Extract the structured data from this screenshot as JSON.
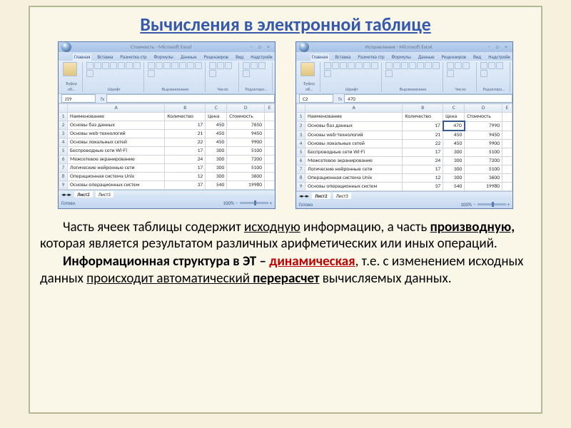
{
  "title": "Вычисления в электронной таблице",
  "screenshots": {
    "left": {
      "window_title": "Стоимость - Microsoft Excel",
      "tabs": [
        "Главная",
        "Вставка",
        "Разметка стр",
        "Формулы",
        "Данные",
        "Рецензиров",
        "Вид",
        "Надстройк"
      ],
      "active_tab": "Главная",
      "ribbon_groups": [
        "Буфер об…",
        "Шрифт",
        "Выравнивание",
        "Число",
        "Редактиро…"
      ],
      "name_box": "J19",
      "formula": "",
      "columns": [
        "",
        "A",
        "B",
        "C",
        "D",
        "E"
      ],
      "rows": [
        {
          "n": "1",
          "cells": [
            "Наименование",
            "Количество",
            "Цена",
            "Стоимость",
            ""
          ]
        },
        {
          "n": "2",
          "cells": [
            "Основы баз данных",
            "17",
            "450",
            "7650",
            ""
          ]
        },
        {
          "n": "3",
          "cells": [
            "Основы web-технологий",
            "21",
            "450",
            "9450",
            ""
          ]
        },
        {
          "n": "4",
          "cells": [
            "Основы локальных сетей",
            "22",
            "450",
            "9900",
            ""
          ]
        },
        {
          "n": "5",
          "cells": [
            "Беспроводные сети Wi-Fi",
            "17",
            "300",
            "5100",
            ""
          ]
        },
        {
          "n": "6",
          "cells": [
            "Межсетевое экранирование",
            "24",
            "300",
            "7200",
            ""
          ]
        },
        {
          "n": "7",
          "cells": [
            "Логические нейронные сети",
            "17",
            "300",
            "5100",
            ""
          ]
        },
        {
          "n": "8",
          "cells": [
            "Операционная система Unix",
            "12",
            "300",
            "3600",
            ""
          ]
        },
        {
          "n": "9",
          "cells": [
            "Основы операционных систем",
            "37",
            "540",
            "19980",
            ""
          ]
        }
      ],
      "sheet_tabs": [
        "Лист2",
        "Лист3"
      ],
      "active_sheet": "Лист2",
      "status": "Готово",
      "zoom": "100%"
    },
    "right": {
      "window_title": "Исправления - Microsoft Excel",
      "tabs": [
        "Главная",
        "Вставка",
        "Разметка стр",
        "Формулы",
        "Данные",
        "Рецензиров",
        "Вид",
        "Надстройк"
      ],
      "active_tab": "Главная",
      "ribbon_groups": [
        "Буфер об…",
        "Шрифт",
        "Выравнивание",
        "Число",
        "Редактиро…"
      ],
      "name_box": "C2",
      "formula": "470",
      "columns": [
        "",
        "A",
        "B",
        "C",
        "D",
        "E"
      ],
      "selected_cell": {
        "row": 0,
        "col": 2
      },
      "rows": [
        {
          "n": "1",
          "cells": [
            "Наименование",
            "Количество",
            "Цена",
            "Стоимость",
            ""
          ]
        },
        {
          "n": "2",
          "cells": [
            "Основы баз данных",
            "17",
            "470",
            "7990",
            ""
          ]
        },
        {
          "n": "3",
          "cells": [
            "Основы web-технологий",
            "21",
            "450",
            "9450",
            ""
          ]
        },
        {
          "n": "4",
          "cells": [
            "Основы локальных сетей",
            "22",
            "450",
            "9900",
            ""
          ]
        },
        {
          "n": "5",
          "cells": [
            "Беспроводные сети Wi-Fi",
            "17",
            "300",
            "5100",
            ""
          ]
        },
        {
          "n": "6",
          "cells": [
            "Межсетевое экранирование",
            "24",
            "300",
            "7200",
            ""
          ]
        },
        {
          "n": "7",
          "cells": [
            "Логические нейронные сети",
            "17",
            "300",
            "5100",
            ""
          ]
        },
        {
          "n": "8",
          "cells": [
            "Операционная система Unix",
            "12",
            "300",
            "3600",
            ""
          ]
        },
        {
          "n": "9",
          "cells": [
            "Основы операционных систем",
            "37",
            "540",
            "19980",
            ""
          ]
        }
      ],
      "sheet_tabs": [
        "Лист2",
        "Лист3"
      ],
      "active_sheet": "Лист2",
      "status": "Готово",
      "zoom": "100%"
    }
  },
  "text": {
    "p1_a": "Часть ячеек таблицы содержит ",
    "p1_u1": "исходную",
    "p1_b": " информацию, а часть ",
    "p1_u2": "производную,",
    "p1_c": " которая является результатом различных арифметических или иных операций.",
    "p2_a": "Информационная структура в ЭТ – ",
    "p2_u1": "динамическая",
    "p2_b": ", т.е. с изменением исходных данных ",
    "p2_u2": "происходит автоматический ",
    "p2_u3": "перерасчет",
    "p2_c": " вычисляемых данных."
  },
  "icons": {
    "min": "–",
    "max": "□",
    "close": "×",
    "fx": "fx",
    "arrows": "◂▸◂▸"
  }
}
